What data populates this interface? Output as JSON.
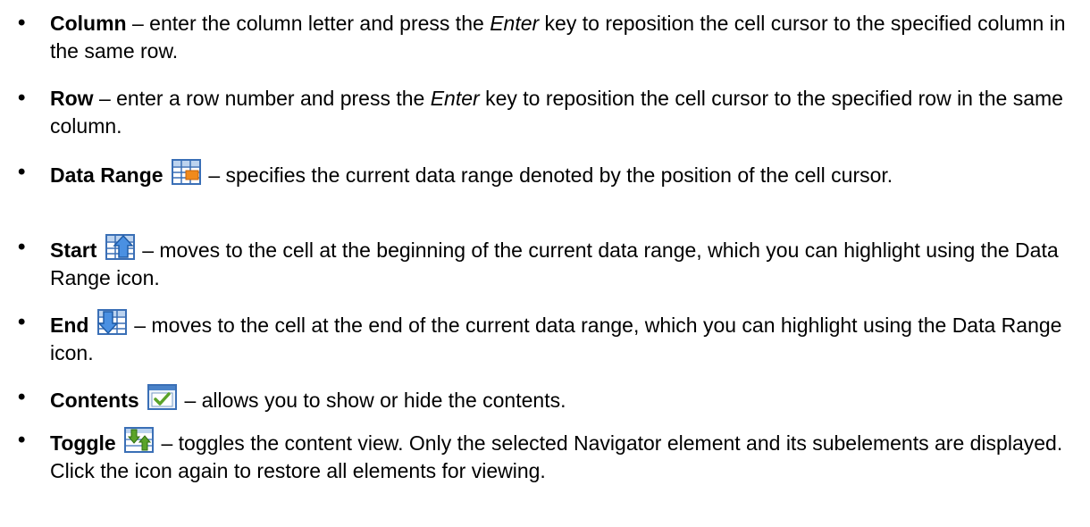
{
  "items": [
    {
      "term": "Column",
      "parts": [
        "– enter the column letter and press the ",
        "Enter",
        " key to reposition the cell cursor to the specified column in the same row."
      ]
    },
    {
      "term": "Row",
      "parts": [
        "–  enter a row number and press the ",
        "Enter",
        " key to reposition the cell cursor to the specified row in the same column."
      ]
    },
    {
      "term": "Data Range",
      "icon": "data-range-icon",
      "description": "– specifies the current data range denoted by the position of the cell cursor."
    },
    {
      "term": "Start",
      "icon": "start-icon",
      "description": "– moves to the cell at the beginning of the current data range, which you can highlight using the Data Range icon."
    },
    {
      "term": "End",
      "icon": "end-icon",
      "description": "– moves to the cell at the end of the current data range, which you can highlight using the Data Range icon."
    },
    {
      "term": "Contents",
      "icon": "contents-icon",
      "description": "– allows you to show or hide the contents."
    },
    {
      "term": "Toggle",
      "icon": "toggle-icon",
      "description": "– toggles the content view. Only the selected Navigator element and its subelements are displayed. Click the icon again to restore all elements for viewing."
    }
  ],
  "bullet_symbol": "•",
  "colors": {
    "text": "#000000",
    "icon_blue": "#2f6fc1",
    "icon_orange": "#f08a1c",
    "icon_green": "#5aa32a"
  }
}
